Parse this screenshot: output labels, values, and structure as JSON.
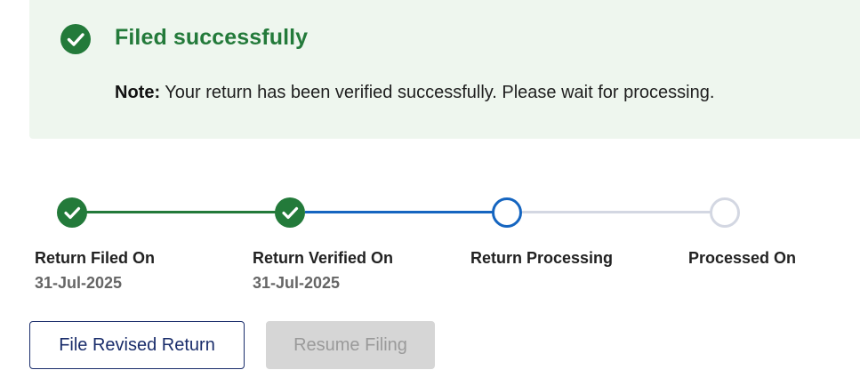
{
  "banner": {
    "title": "Filed successfully",
    "note_label": "Note:",
    "note_text": " Your return has been verified successfully. Please wait for processing.",
    "color": "#237a3a",
    "background": "#eef6ee"
  },
  "stepper": {
    "steps": [
      {
        "label": "Return Filed On",
        "date": "31-Jul-2025",
        "status": "completed",
        "icon": "check-icon"
      },
      {
        "label": "Return Verified On",
        "date": "31-Jul-2025",
        "status": "completed",
        "icon": "check-icon"
      },
      {
        "label": "Return Processing",
        "date": "",
        "status": "current",
        "icon": ""
      },
      {
        "label": "Processed On",
        "date": "",
        "status": "pending",
        "icon": ""
      }
    ],
    "colors": {
      "completed": "#237a3a",
      "current": "#1565c0",
      "pending": "#d3d7e2"
    }
  },
  "actions": {
    "file_revised_label": "File Revised Return",
    "resume_filing_label": "Resume Filing"
  }
}
